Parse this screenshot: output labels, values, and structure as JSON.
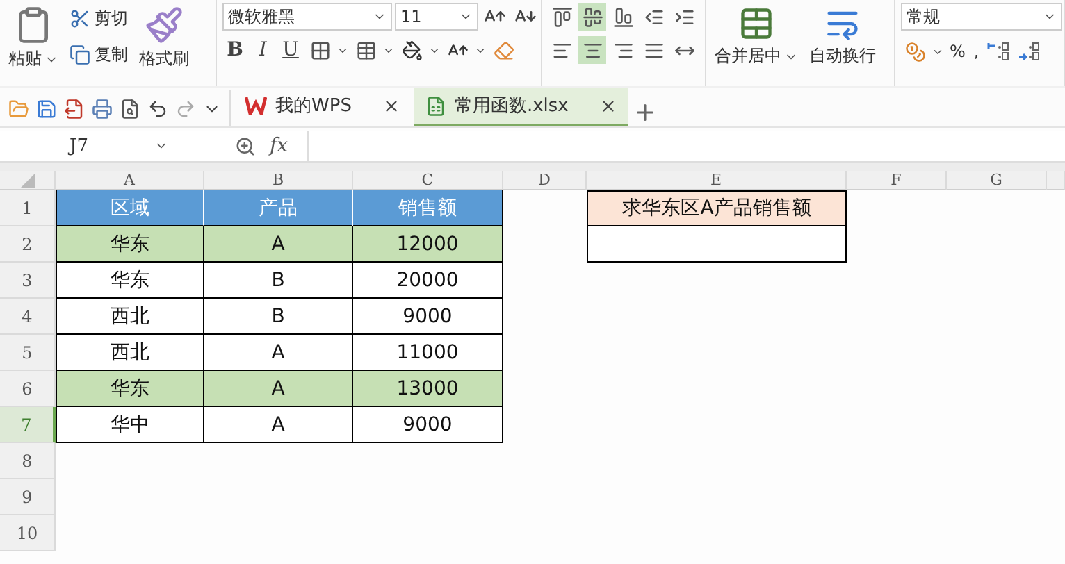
{
  "ribbon": {
    "clipboard": {
      "paste": "粘贴",
      "cut": "剪切",
      "copy": "复制",
      "format_painter": "格式刷"
    },
    "font": {
      "name": "微软雅黑",
      "size": "11",
      "styles": [
        "B",
        "I",
        "U"
      ]
    },
    "alignment": {
      "vertical": [
        {
          "kind": "top",
          "selected": false
        },
        {
          "kind": "middle",
          "selected": true
        },
        {
          "kind": "bottom",
          "selected": false
        },
        {
          "kind": "outdent",
          "selected": false
        },
        {
          "kind": "indent",
          "selected": false
        }
      ],
      "horizontal": [
        {
          "kind": "left",
          "selected": false
        },
        {
          "kind": "center",
          "selected": true
        },
        {
          "kind": "right",
          "selected": false
        },
        {
          "kind": "justify",
          "selected": false
        },
        {
          "kind": "distribute",
          "selected": false
        }
      ]
    },
    "merge_center": "合并居中",
    "wrap_text": "自动换行",
    "number": {
      "format": "常规",
      "percent": "%",
      "comma": ","
    }
  },
  "tabs": [
    {
      "label": "我的WPS",
      "kind": "home",
      "selected": false
    },
    {
      "label": "常用函数.xlsx",
      "kind": "sheet",
      "selected": true
    }
  ],
  "formula_bar": {
    "name_box": "J7",
    "fx": "fx"
  },
  "columns": [
    "A",
    "B",
    "C",
    "D",
    "E",
    "F",
    "G"
  ],
  "rows": [
    {
      "header": "1",
      "active": false,
      "kind": "title",
      "cells": [
        "区域",
        "产品",
        "销售额"
      ],
      "query": "求华东区A产品销售额"
    },
    {
      "header": "2",
      "active": false,
      "kind": "data",
      "highlighted": true,
      "cells": [
        "华东",
        "A",
        "12000"
      ],
      "answer": ""
    },
    {
      "header": "3",
      "active": false,
      "kind": "data",
      "highlighted": false,
      "cells": [
        "华东",
        "B",
        "20000"
      ]
    },
    {
      "header": "4",
      "active": false,
      "kind": "data",
      "highlighted": false,
      "cells": [
        "西北",
        "B",
        "9000"
      ]
    },
    {
      "header": "5",
      "active": false,
      "kind": "data",
      "highlighted": false,
      "cells": [
        "西北",
        "A",
        "11000"
      ]
    },
    {
      "header": "6",
      "active": false,
      "kind": "data",
      "highlighted": true,
      "cells": [
        "华东",
        "A",
        "13000"
      ]
    },
    {
      "header": "7",
      "active": true,
      "kind": "data",
      "highlighted": false,
      "cells": [
        "华中",
        "A",
        "9000"
      ]
    },
    {
      "header": "8",
      "active": false,
      "kind": "empty"
    },
    {
      "header": "9",
      "active": false,
      "kind": "empty"
    },
    {
      "header": "10",
      "active": false,
      "kind": "empty"
    }
  ]
}
